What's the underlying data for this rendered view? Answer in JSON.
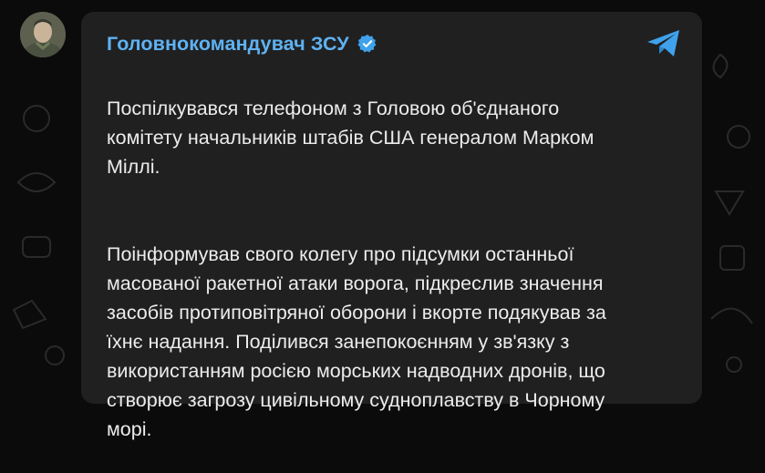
{
  "post": {
    "channel_name": "Головнокомандувач ЗСУ",
    "paragraphs": [
      "Поспілкувався телефоном з Головою об'єднаного\nкомітету начальників штабів США генералом Марком\nМіллі.",
      "Поінформував свого колегу про підсумки останньої\nмасованої ракетної атаки ворога, підкреслив значення\nзасобів протиповітряної оборони і вкорте подякував за\nїхнє надання. Поділився занепокоєнням у зв'язку з\nвикористанням росією морських надводних дронів, що\nстворює загрозу цивільному судноплавству в Чорному\nморі."
    ]
  },
  "icons": {
    "verified": "verified-badge-icon",
    "share": "telegram-share-icon",
    "avatar": "channel-avatar"
  },
  "colors": {
    "background": "#0b0b0c",
    "bubble": "#202021",
    "channel_name": "#5fb2f2",
    "text": "#ececec",
    "accent": "#3fa2ea"
  }
}
